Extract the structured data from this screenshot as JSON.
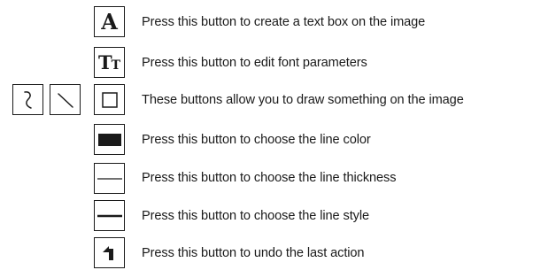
{
  "rows": [
    {
      "icon": "text-box-icon",
      "glyph": "A",
      "text": "Press this button to create a text box on the image"
    },
    {
      "icon": "font-parameters-icon",
      "glyph_big": "T",
      "glyph_small": "T",
      "text": "Press this button to edit font parameters"
    },
    {
      "icon": "rectangle-draw-icon",
      "text": "These buttons allow you to draw something on the image"
    },
    {
      "icon": "line-color-icon",
      "text": "Press this button to choose the line color"
    },
    {
      "icon": "line-thickness-icon",
      "text": "Press this button to choose the line thickness"
    },
    {
      "icon": "line-style-icon",
      "text": "Press this button to choose the line style"
    },
    {
      "icon": "undo-icon",
      "text": "Press this button to undo the last action"
    }
  ],
  "draw_tools": [
    {
      "icon": "freehand-draw-icon"
    },
    {
      "icon": "line-draw-icon"
    },
    {
      "icon": "rectangle-draw-icon"
    }
  ]
}
